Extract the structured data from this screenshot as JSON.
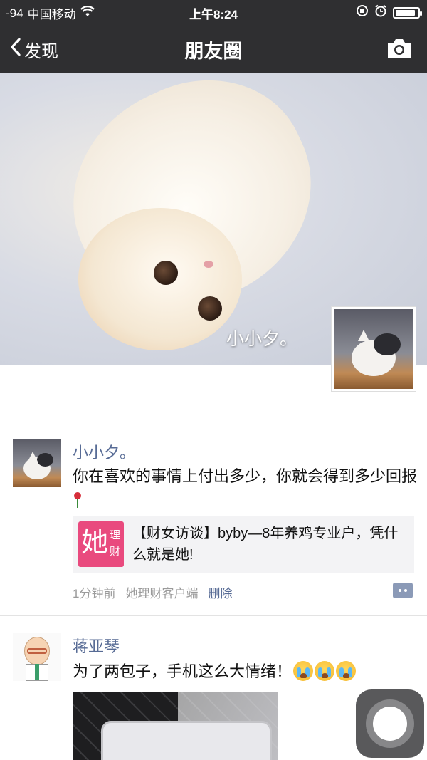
{
  "status_bar": {
    "signal": "-94",
    "carrier": "中国移动",
    "time": "上午8:24",
    "battery_fill": 0.9
  },
  "nav": {
    "back_label": "发现",
    "title": "朋友圈",
    "camera_icon": "camera-icon"
  },
  "cover": {
    "user_name": "小小夕。"
  },
  "posts": [
    {
      "name": "小小夕。",
      "text": "你在喜欢的事情上付出多少，你就会得到多少回报",
      "share": {
        "logo_big": "她",
        "logo_small": "理财",
        "text": "【财女访谈】byby—8年养鸡专业户，凭什么就是她!"
      },
      "time": "1分钟前",
      "source": "她理财客户端",
      "delete_label": "删除"
    },
    {
      "name": "蒋亚琴",
      "text": "为了两包子，手机这么大情绪！"
    }
  ]
}
